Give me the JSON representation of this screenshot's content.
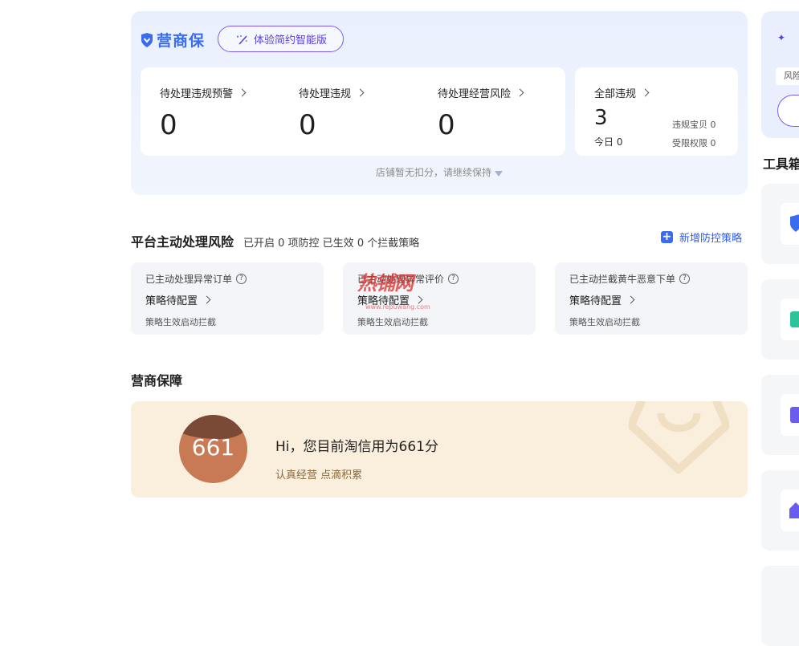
{
  "brand": {
    "name": "营商保",
    "pill_label": "体验简约智能版"
  },
  "stats": [
    {
      "label": "待处理违规预警",
      "value": "0"
    },
    {
      "label": "待处理违规",
      "value": "0"
    },
    {
      "label": "待处理经营风险",
      "value": "0"
    }
  ],
  "all_violations": {
    "label": "全部违规",
    "value": "3",
    "today_label": "今日",
    "today_value": "0",
    "item1_label": "违规宝贝",
    "item1_value": "0",
    "item2_label": "受限权限",
    "item2_value": "0"
  },
  "hint": "店铺暂无扣分，请继续保持",
  "risk": {
    "title": "平台主动处理风险",
    "subtitle": "已开启 0 项防控 已生效 0 个拦截策略",
    "add_label": "新增防控策略",
    "cards": [
      {
        "title": "已主动处理异常订单",
        "link": "策略待配置",
        "desc": "策略生效启动拦截"
      },
      {
        "title": "已主动处理异常评价",
        "link": "策略待配置",
        "desc": "策略生效启动拦截"
      },
      {
        "title": "已主动拦截黄牛恶意下单",
        "link": "策略待配置",
        "desc": "策略生效启动拦截"
      }
    ]
  },
  "guarantee": {
    "title": "营商保障",
    "score": "661",
    "line1": "Hi，您目前淘信用为661分",
    "line2": "认真经营 点滴积累"
  },
  "right": {
    "tag": "风险",
    "toolbox_title": "工具箱"
  },
  "watermark": {
    "text": "热铺网",
    "url": "www.repuwang.com"
  },
  "colors": {
    "accent": "#3a6cf0",
    "pill": "#7b5cf0",
    "guarantee_bg": "#faeedd",
    "score": "#c87a55"
  }
}
